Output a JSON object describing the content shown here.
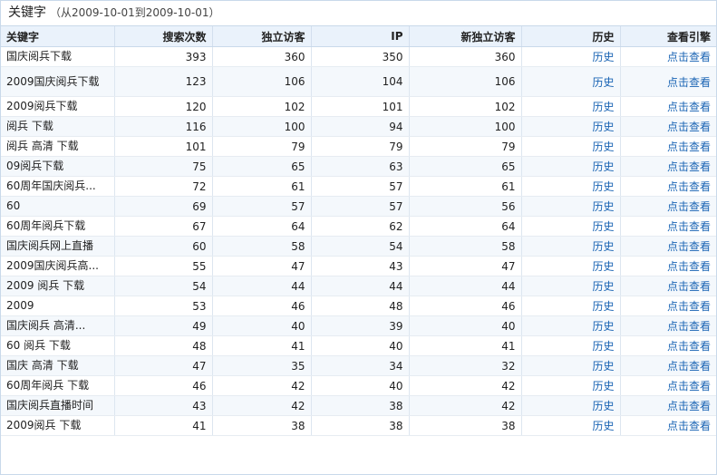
{
  "header": {
    "title": "关键字",
    "range": "（从2009-10-01到2009-10-01）"
  },
  "columns": [
    "关键字",
    "搜索次数",
    "独立访客",
    "IP",
    "新独立访客",
    "历史",
    "查看引擎"
  ],
  "rows": [
    {
      "keyword": "国庆阅兵下载",
      "searches": "393",
      "visitors": "360",
      "ip": "350",
      "new_visitors": "360",
      "history": "历史",
      "engine": "点击查看"
    },
    {
      "keyword": "2009国庆阅兵下载",
      "searches": "123",
      "visitors": "106",
      "ip": "104",
      "new_visitors": "106",
      "history": "历史",
      "engine": "点击查看"
    },
    {
      "keyword": "2009阅兵下载",
      "searches": "120",
      "visitors": "102",
      "ip": "101",
      "new_visitors": "102",
      "history": "历史",
      "engine": "点击查看"
    },
    {
      "keyword": "阅兵 下载",
      "searches": "116",
      "visitors": "100",
      "ip": "94",
      "new_visitors": "100",
      "history": "历史",
      "engine": "点击查看"
    },
    {
      "keyword": "阅兵 高清 下载",
      "searches": "101",
      "visitors": "79",
      "ip": "79",
      "new_visitors": "79",
      "history": "历史",
      "engine": "点击查看"
    },
    {
      "keyword": "09阅兵下载",
      "searches": "75",
      "visitors": "65",
      "ip": "63",
      "new_visitors": "65",
      "history": "历史",
      "engine": "点击查看"
    },
    {
      "keyword": "60周年国庆阅兵...",
      "searches": "72",
      "visitors": "61",
      "ip": "57",
      "new_visitors": "61",
      "history": "历史",
      "engine": "点击查看"
    },
    {
      "keyword": "60",
      "searches": "69",
      "visitors": "57",
      "ip": "57",
      "new_visitors": "56",
      "history": "历史",
      "engine": "点击查看"
    },
    {
      "keyword": "60周年阅兵下载",
      "searches": "67",
      "visitors": "64",
      "ip": "62",
      "new_visitors": "64",
      "history": "历史",
      "engine": "点击查看"
    },
    {
      "keyword": "国庆阅兵网上直播",
      "searches": "60",
      "visitors": "58",
      "ip": "54",
      "new_visitors": "58",
      "history": "历史",
      "engine": "点击查看"
    },
    {
      "keyword": "2009国庆阅兵高...",
      "searches": "55",
      "visitors": "47",
      "ip": "43",
      "new_visitors": "47",
      "history": "历史",
      "engine": "点击查看"
    },
    {
      "keyword": "2009 阅兵 下载",
      "searches": "54",
      "visitors": "44",
      "ip": "44",
      "new_visitors": "44",
      "history": "历史",
      "engine": "点击查看"
    },
    {
      "keyword": "2009",
      "searches": "53",
      "visitors": "46",
      "ip": "48",
      "new_visitors": "46",
      "history": "历史",
      "engine": "点击查看"
    },
    {
      "keyword": "国庆阅兵 高清...",
      "searches": "49",
      "visitors": "40",
      "ip": "39",
      "new_visitors": "40",
      "history": "历史",
      "engine": "点击查看"
    },
    {
      "keyword": "60 阅兵 下载",
      "searches": "48",
      "visitors": "41",
      "ip": "40",
      "new_visitors": "41",
      "history": "历史",
      "engine": "点击查看"
    },
    {
      "keyword": "国庆 高清 下载",
      "searches": "47",
      "visitors": "35",
      "ip": "34",
      "new_visitors": "32",
      "history": "历史",
      "engine": "点击查看"
    },
    {
      "keyword": "60周年阅兵 下载",
      "searches": "46",
      "visitors": "42",
      "ip": "40",
      "new_visitors": "42",
      "history": "历史",
      "engine": "点击查看"
    },
    {
      "keyword": "国庆阅兵直播时间",
      "searches": "43",
      "visitors": "42",
      "ip": "38",
      "new_visitors": "42",
      "history": "历史",
      "engine": "点击查看"
    },
    {
      "keyword": "2009阅兵 下载",
      "searches": "41",
      "visitors": "38",
      "ip": "38",
      "new_visitors": "38",
      "history": "历史",
      "engine": "点击查看"
    }
  ],
  "colors": {
    "link": "#1a64b4",
    "header_bg": "#eaf2fb",
    "row_alt": "#f4f8fc",
    "border": "#c9d9ea"
  }
}
